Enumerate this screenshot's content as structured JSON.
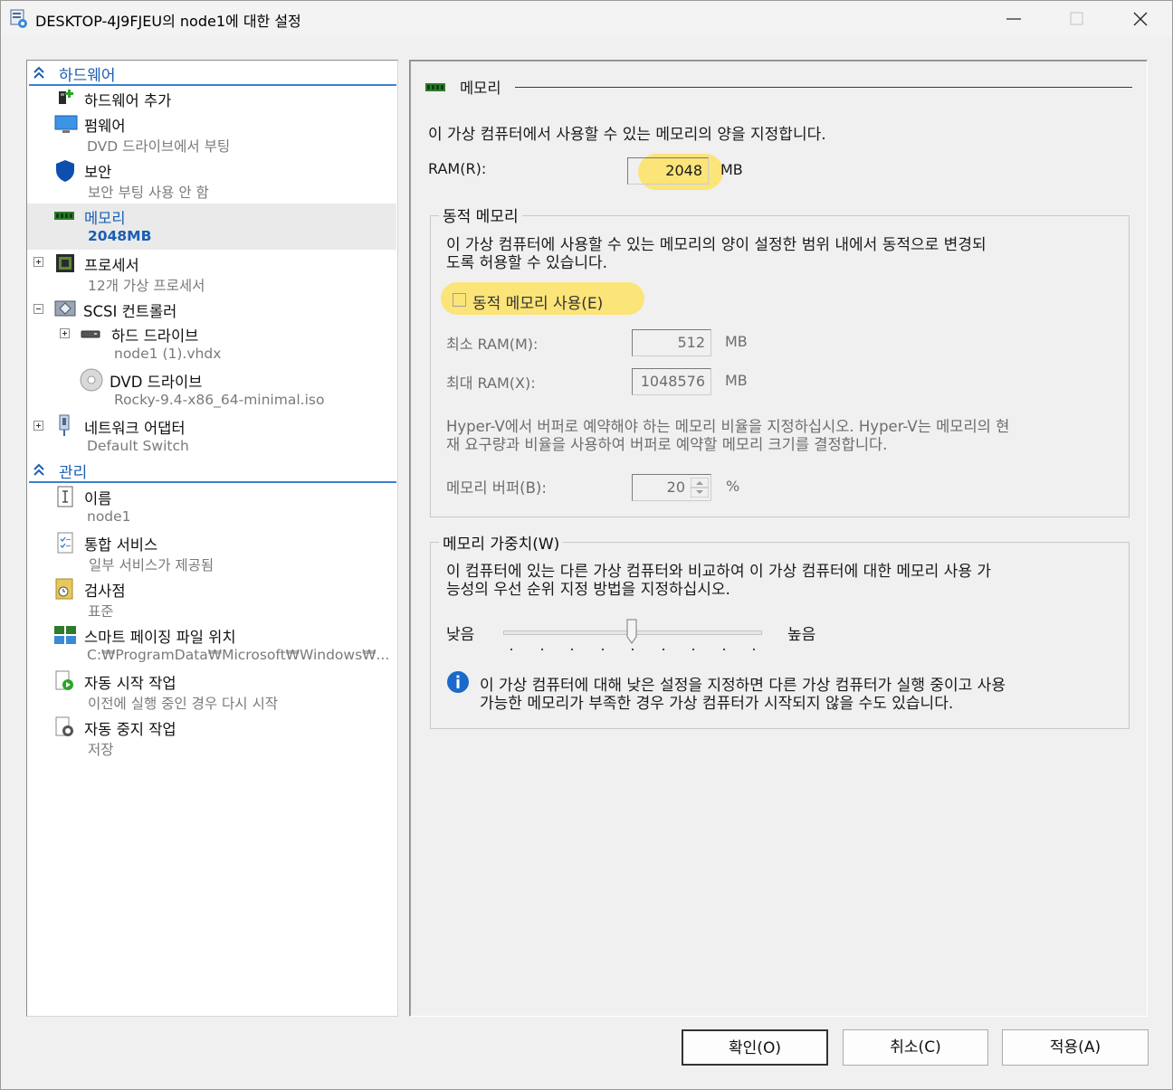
{
  "window": {
    "title": "DESKTOP-4J9FJEU의 node1에 대한 설정"
  },
  "tree": {
    "hardware_header": "하드웨어",
    "items": [
      {
        "name": "하드웨어 추가",
        "sub": ""
      },
      {
        "name": "펌웨어",
        "sub": "DVD 드라이브에서 부팅"
      },
      {
        "name": "보안",
        "sub": "보안 부팅 사용 안 함"
      },
      {
        "name": "메모리",
        "sub": "2048MB"
      },
      {
        "name": "프로세서",
        "sub": "12개 가상 프로세서"
      },
      {
        "name": "SCSI 컨트롤러",
        "sub": ""
      },
      {
        "name": "하드 드라이브",
        "sub": "node1 (1).vhdx"
      },
      {
        "name": "DVD 드라이브",
        "sub": "Rocky-9.4-x86_64-minimal.iso"
      },
      {
        "name": "네트워크 어댑터",
        "sub": "Default Switch"
      }
    ],
    "management_header": "관리",
    "mgmt_items": [
      {
        "name": "이름",
        "sub": "node1"
      },
      {
        "name": "통합 서비스",
        "sub": "일부 서비스가 제공됨"
      },
      {
        "name": "검사점",
        "sub": "표준"
      },
      {
        "name": "스마트 페이징 파일 위치",
        "sub": "C:₩ProgramData₩Microsoft₩Windows₩..."
      },
      {
        "name": "자동 시작 작업",
        "sub": "이전에 실행 중인 경우 다시 시작"
      },
      {
        "name": "자동 중지 작업",
        "sub": "저장"
      }
    ]
  },
  "memory": {
    "section_title": "메모리",
    "description": "이 가상 컴퓨터에서 사용할 수 있는 메모리의 양을 지정합니다.",
    "ram_label": "RAM(R):",
    "ram_value": "2048",
    "ram_unit": "MB",
    "dynamic": {
      "title": "동적 메모리",
      "description_line1": "이 가상 컴퓨터에 사용할 수 있는 메모리의 양이 설정한 범위 내에서 동적으로 변경되",
      "description_line2": "도록 허용할 수 있습니다.",
      "enable_label": "동적 메모리 사용(E)",
      "enabled": false,
      "min_label": "최소 RAM(M):",
      "min_value": "512",
      "min_unit": "MB",
      "max_label": "최대 RAM(X):",
      "max_value": "1048576",
      "max_unit": "MB",
      "buffer_desc_line1": "Hyper-V에서 버퍼로 예약해야 하는 메모리 비율을 지정하십시오. Hyper-V는 메모리의 현",
      "buffer_desc_line2": "재 요구량과 비율을 사용하여 버퍼로 예약할 메모리 크기를 결정합니다.",
      "buffer_label": "메모리 버퍼(B):",
      "buffer_value": "20",
      "buffer_unit": "%"
    },
    "weight": {
      "title": "메모리 가중치(W)",
      "description_line1": "이 컴퓨터에 있는 다른 가상 컴퓨터와 비교하여 이 가상 컴퓨터에 대한 메모리 사용 가",
      "description_line2": "능성의 우선 순위 지정 방법을 지정하십시오.",
      "low_label": "낮음",
      "high_label": "높음",
      "slider_fraction": 0.5,
      "info_line1": "이 가상 컴퓨터에 대해 낮은 설정을 지정하면 다른 가상 컴퓨터가 실행 중이고 사용",
      "info_line2": "가능한 메모리가 부족한 경우 가상 컴퓨터가 시작되지 않을 수도 있습니다."
    }
  },
  "buttons": {
    "ok": "확인(O)",
    "cancel": "취소(C)",
    "apply": "적용(A)"
  },
  "colors": {
    "accent": "#1a5fb4",
    "highlight": "#ffe050"
  }
}
